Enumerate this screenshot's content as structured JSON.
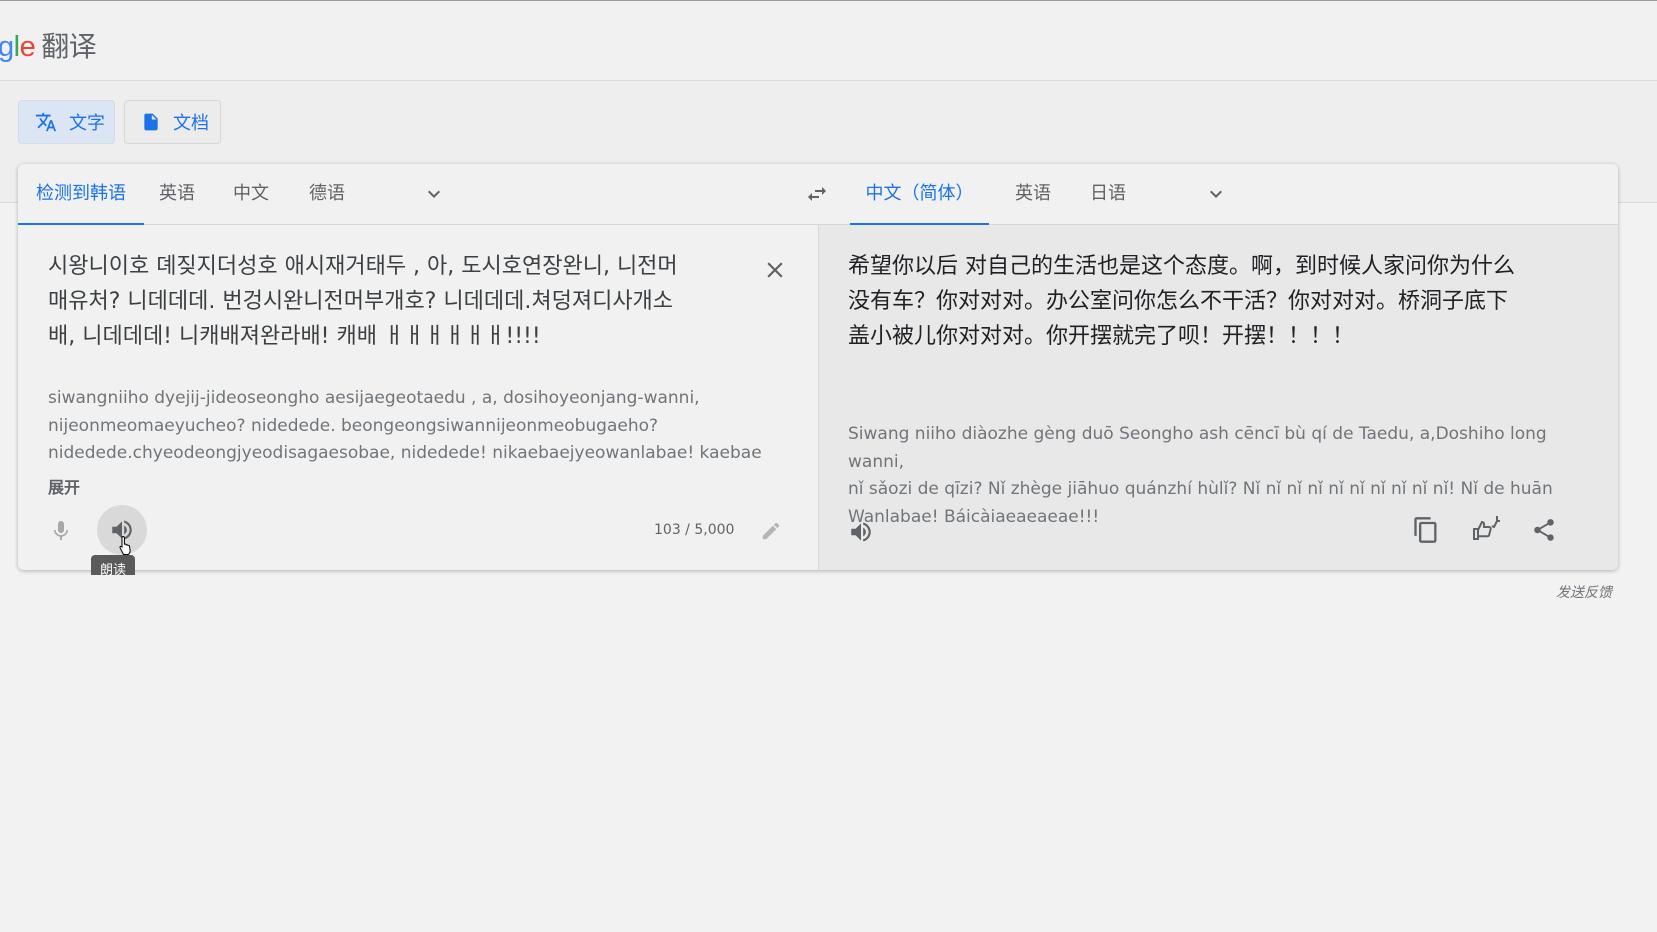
{
  "header": {
    "logo_partial": {
      "g": "g",
      "l": "l",
      "e": "e"
    },
    "product_name": "翻译"
  },
  "modes": [
    {
      "label": "文字",
      "icon": "translate-icon",
      "active": true
    },
    {
      "label": "文档",
      "icon": "document-icon",
      "active": false
    }
  ],
  "source_langs": [
    {
      "label": "检测到韩语",
      "active": true
    },
    {
      "label": "英语",
      "active": false
    },
    {
      "label": "中文",
      "active": false
    },
    {
      "label": "德语",
      "active": false
    }
  ],
  "target_langs": [
    {
      "label": "中文（简体）",
      "active": true
    },
    {
      "label": "英语",
      "active": false
    },
    {
      "label": "日语",
      "active": false
    }
  ],
  "source": {
    "text": "시왕니이호 뎨짖지더성호 애시재거태두 , 아, 도시호연장완니, 니전머\n매유처? 니데데데. 번겅시완니전머부개호? 니데데데.쳐덩져디사개소\n배, 니데데데! 니캐배져완라배! 캐배 ㅐㅐㅐㅐㅐㅐ!!!!",
    "transliteration": "siwangniiho dyejij-jideoseongho aesijaegeotaedu , a, dosihoyeonjang-wanni,\nnijeonmeomaeyucheo? nidedede. beongeongsiwannijeonmeobugaeho?\nnidedede.chyeodeongjyeodisagaesobae, nidedede! nikaebaejyeowanlabae! kaebae",
    "expand_label": "展开",
    "char_count": "103 / 5,000",
    "tooltip": "朗读"
  },
  "target": {
    "text": "希望你以后 对自己的生活也是这个态度。啊，到时候人家问你为什么\n没有车？你对对对。办公室问你怎么不干活？你对对对。桥洞子底下\n盖小被儿你对对对。你开摆就完了呗！开摆！！！！",
    "transliteration": "Siwang niiho diàozhe gèng duō Seongho ash cēncī bù qí de Taedu, a,Doshiho long wanni,\nnǐ sǎozi de qīzi? Nǐ zhège jiāhuo quánzhí hùlǐ? Nǐ nǐ nǐ nǐ nǐ nǐ nǐ nǐ nǐ nǐ! Nǐ de huān\nWanlabae! Báicàiaeaeaeae!!!"
  },
  "footer": {
    "feedback": "发送反馈"
  },
  "colors": {
    "accent": "#1a73e8",
    "google_blue": "#4285f4",
    "google_green": "#34a853",
    "google_red": "#ea4335"
  }
}
